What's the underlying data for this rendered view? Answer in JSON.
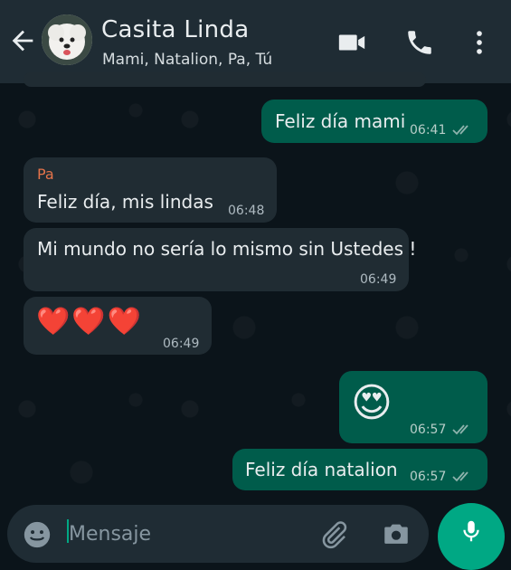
{
  "header": {
    "title": "Casita Linda",
    "subtitle": "Mami, Natalion, Pa, Tú",
    "icons": [
      "back-arrow-icon",
      "video-call-icon",
      "phone-icon",
      "more-options-icon"
    ]
  },
  "messages": [
    {
      "direction": "out",
      "text": "Feliz día mami",
      "time": "06:41",
      "status": "read"
    },
    {
      "direction": "in",
      "sender": "Pa",
      "text": "Feliz día, mis lindas",
      "time": "06:48"
    },
    {
      "direction": "in",
      "text": "Mi mundo no sería lo mismo sin Ustedes !",
      "time": "06:49"
    },
    {
      "direction": "in",
      "text": "❤️❤️❤️",
      "time": "06:49"
    },
    {
      "direction": "out",
      "text": "😍",
      "time": "06:57",
      "status": "read"
    },
    {
      "direction": "out",
      "text": "Feliz día natalion",
      "time": "06:57",
      "status": "read"
    }
  ],
  "composer": {
    "placeholder": "Mensaje",
    "icons": [
      "emoji-icon",
      "attach-icon",
      "camera-icon",
      "mic-icon"
    ]
  },
  "colors": {
    "header": "#1f2c34",
    "background": "#0b141a",
    "incoming": "#202c33",
    "outgoing": "#005c4b",
    "accent": "#00a884",
    "sender_name": "#e5734a"
  }
}
